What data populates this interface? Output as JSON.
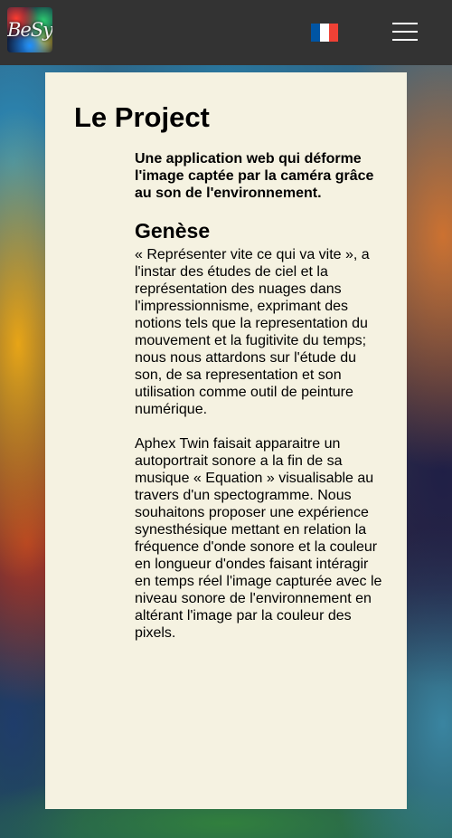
{
  "header": {
    "logo_text": "BeSy",
    "flag_colors": [
      "#0055a4",
      "#ffffff",
      "#ef4135"
    ],
    "flag_icon": "france-flag-icon",
    "menu_icon": "hamburger-menu-icon"
  },
  "main": {
    "title": "Le Project",
    "lead": "Une application web qui déforme l'image captée par la caméra grâce au son de l'environnement.",
    "section_title": "Genèse",
    "paragraph_1": "« Représenter vite ce qui va vite », a l'instar des études de ciel et la représentation des nuages dans l'impressionnisme, exprimant des notions tels que la representation du mouvement et la fugitivite du temps; nous nous attardons sur l'étude du son, de sa representation et son utilisation comme outil de peinture numérique.",
    "paragraph_2": "Aphex Twin faisait apparaitre un autoportrait sonore a la fin de sa musique « Equation » visualisable au travers d'un spectogramme. Nous souhaitons proposer une expérience synesthésique mettant en relation la fréquence d'onde sonore et la couleur en longueur d'ondes faisant intéragir en temps réel l'image capturée avec le niveau sonore de l'environnement en altérant l'image par la couleur des pixels."
  },
  "colors": {
    "header_bg": "#333333",
    "card_bg": "#f5f2e1"
  }
}
